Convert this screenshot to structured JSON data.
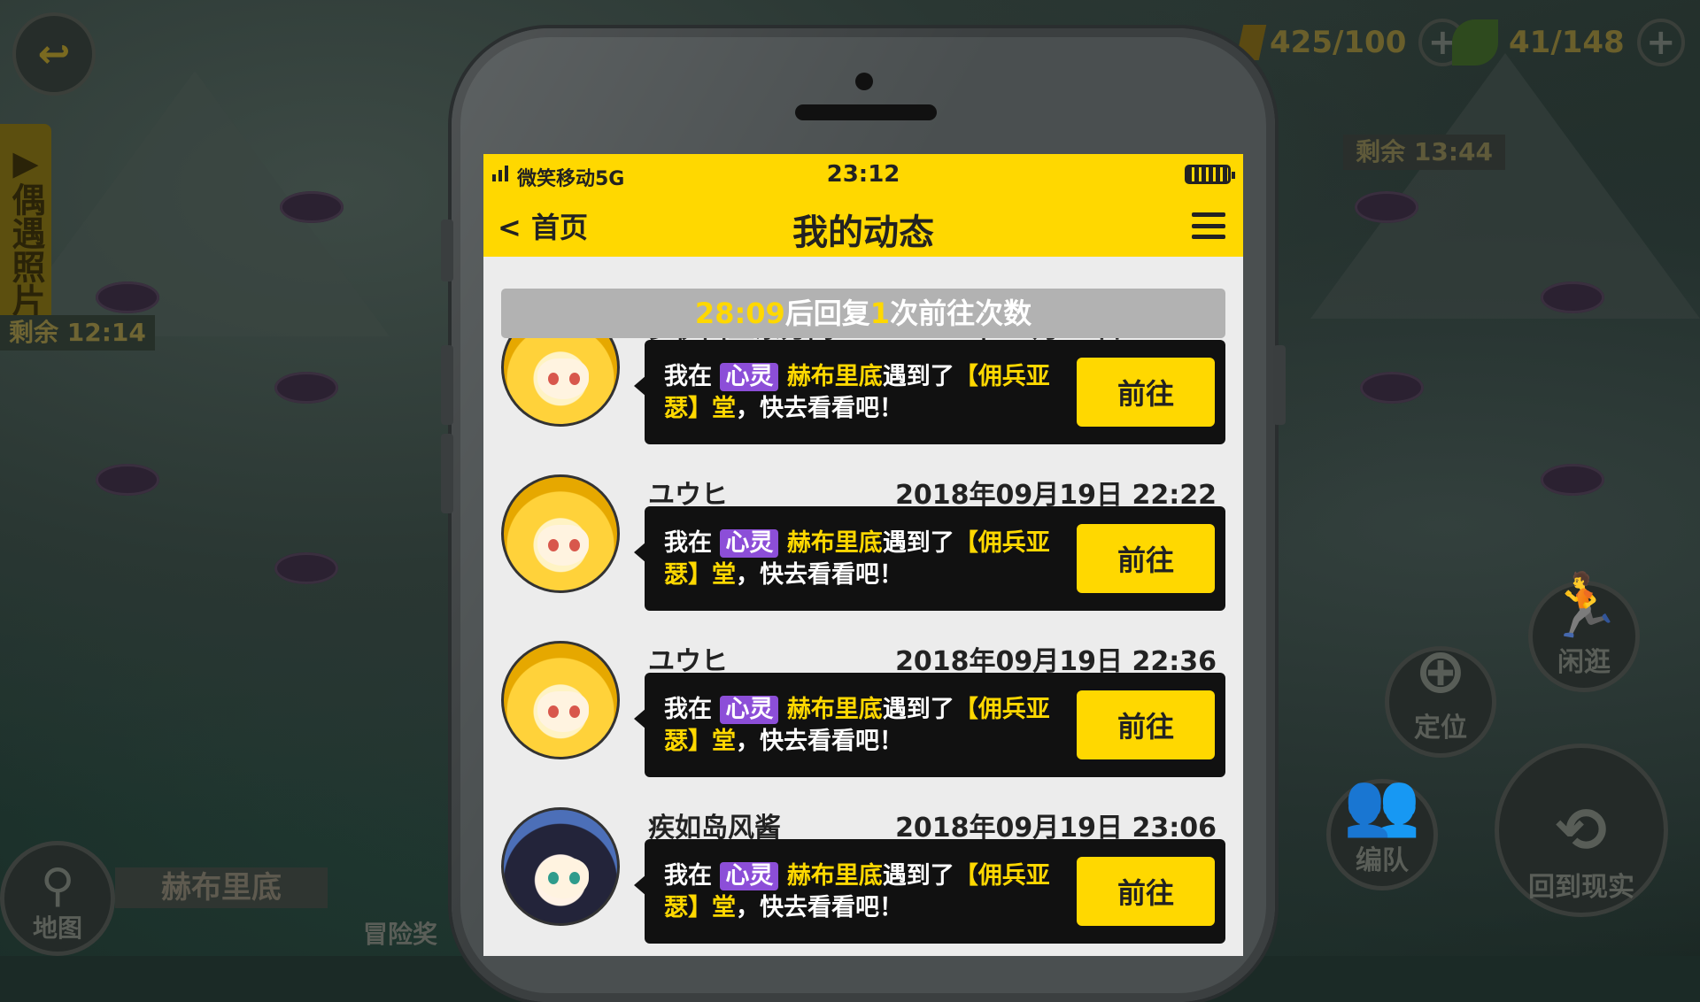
{
  "hud": {
    "back_icon": "back-arrow-icon",
    "side_tab_label": "▶偶遇照片",
    "side_timer": "剩余 12:14",
    "resource_1": "425/100",
    "resource_2": "41/148",
    "plus_label": "+",
    "right_timer": "剩余 13:44",
    "map_label": "地图",
    "location_label": "赫布里底",
    "adventure_label": "冒险奖",
    "btn_wander": "闲逛",
    "btn_locate": "定位",
    "btn_team": "编队",
    "btn_return": "回到现实"
  },
  "phone": {
    "status": {
      "carrier": "微笑移动5G",
      "time": "23:12"
    },
    "nav": {
      "back_label": "< 首页",
      "title": "我的动态"
    },
    "banner": {
      "countdown": "28:09",
      "text_a": "后回复",
      "count": "1",
      "text_b": "次前往次数"
    },
    "feed": [
      {
        "name": "罗伊西亚东方阁",
        "date": "2018年09月19日 22:21",
        "msg_prefix": "我在",
        "tag": "心灵",
        "place": "赫布里底",
        "msg_mid": "遇到了",
        "target": "【佣兵亚瑟】堂",
        "msg_suffix": "，快去看看吧！",
        "button": "前往",
        "avatar": "blonde"
      },
      {
        "name": "ユウヒ",
        "date": "2018年09月19日 22:22",
        "msg_prefix": "我在",
        "tag": "心灵",
        "place": "赫布里底",
        "msg_mid": "遇到了",
        "target": "【佣兵亚瑟】堂",
        "msg_suffix": "，快去看看吧！",
        "button": "前往",
        "avatar": "blonde"
      },
      {
        "name": "ユウヒ",
        "date": "2018年09月19日 22:36",
        "msg_prefix": "我在",
        "tag": "心灵",
        "place": "赫布里底",
        "msg_mid": "遇到了",
        "target": "【佣兵亚瑟】堂",
        "msg_suffix": "，快去看看吧！",
        "button": "前往",
        "avatar": "blonde"
      },
      {
        "name": "疾如岛风酱",
        "date": "2018年09月19日 23:06",
        "msg_prefix": "我在",
        "tag": "心灵",
        "place": "赫布里底",
        "msg_mid": "遇到了",
        "target": "【佣兵亚瑟】堂",
        "msg_suffix": "，快去看看吧！",
        "button": "前往",
        "avatar": "dark"
      }
    ]
  },
  "colors": {
    "accent_yellow": "#ffd800",
    "tag_purple": "#8c4ed8",
    "bubble_black": "#111111"
  }
}
